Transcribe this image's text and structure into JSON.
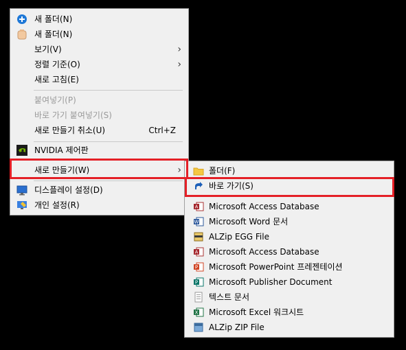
{
  "main_menu": {
    "items": [
      {
        "label": "새 폴더(N)",
        "icon": "plus-circle-icon"
      },
      {
        "label": "새 폴더(N)",
        "icon": "folder-peach-icon"
      },
      {
        "label": "보기(V)",
        "submenu": true
      },
      {
        "label": "정렬 기준(O)",
        "submenu": true
      },
      {
        "label": "새로 고침(E)"
      },
      {
        "label": "붙여넣기(P)",
        "disabled": true
      },
      {
        "label": "바로 가기 붙여넣기(S)",
        "disabled": true
      },
      {
        "label": "새로 만들기 취소(U)",
        "accel": "Ctrl+Z"
      },
      {
        "label": "NVIDIA 제어판",
        "icon": "nvidia-icon"
      },
      {
        "label": "새로 만들기(W)",
        "submenu": true,
        "highlighted": true
      },
      {
        "label": "디스플레이 설정(D)",
        "icon": "display-icon"
      },
      {
        "label": "개인 설정(R)",
        "icon": "personalize-icon"
      }
    ]
  },
  "sub_menu": {
    "items": [
      {
        "label": "폴더(F)",
        "icon": "folder-icon"
      },
      {
        "label": "바로 가기(S)",
        "icon": "shortcut-icon",
        "highlighted": true
      },
      {
        "label": "Microsoft Access Database",
        "icon": "access-icon"
      },
      {
        "label": "Microsoft Word 문서",
        "icon": "word-icon"
      },
      {
        "label": "ALZip EGG File",
        "icon": "alzip-egg-icon"
      },
      {
        "label": "Microsoft Access Database",
        "icon": "access-icon"
      },
      {
        "label": "Microsoft PowerPoint 프레젠테이션",
        "icon": "powerpoint-icon"
      },
      {
        "label": "Microsoft Publisher Document",
        "icon": "publisher-icon"
      },
      {
        "label": "텍스트 문서",
        "icon": "text-document-icon"
      },
      {
        "label": "Microsoft Excel 워크시트",
        "icon": "excel-icon"
      },
      {
        "label": "ALZip ZIP File",
        "icon": "alzip-zip-icon"
      }
    ]
  },
  "colors": {
    "highlight_border": "#e41f26",
    "menu_bg": "#f0f0f0",
    "disabled_text": "#9a9a9a"
  }
}
